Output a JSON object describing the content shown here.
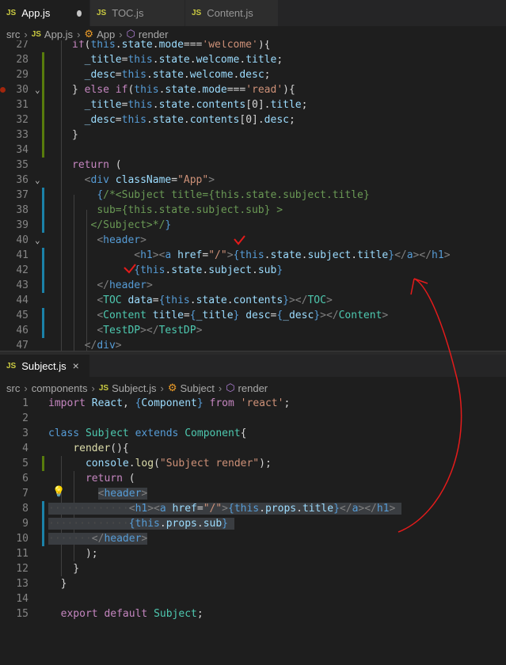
{
  "tabs": [
    {
      "label": "App.js",
      "active": true,
      "modified": true
    },
    {
      "label": "TOC.js",
      "active": false
    },
    {
      "label": "Content.js",
      "active": false
    }
  ],
  "breadcrumb_top": {
    "folder": "src",
    "file": "App.js",
    "class": "App",
    "method": "render"
  },
  "breadcrumb_bottom": {
    "folder": "src",
    "sub": "components",
    "file": "Subject.js",
    "class": "Subject",
    "method": "render"
  },
  "bottom_tab": {
    "label": "Subject.js",
    "close": "×"
  },
  "top_lines": [
    {
      "n": "27",
      "html": "<span class='c'>if</span>(<span class='k'>this</span>.<span class='v'>state</span>.<span class='v'>mode</span>===<span class='s'>'welcome'</span>){"
    },
    {
      "n": "28",
      "html": "  <span class='v'>_title</span>=<span class='k'>this</span>.<span class='v'>state</span>.<span class='v'>welcome</span>.<span class='v'>title</span>;"
    },
    {
      "n": "29",
      "html": "  <span class='v'>_desc</span>=<span class='k'>this</span>.<span class='v'>state</span>.<span class='v'>welcome</span>.<span class='v'>desc</span>;"
    },
    {
      "n": "30",
      "html": "} <span class='c'>else if</span>(<span class='k'>this</span>.<span class='v'>state</span>.<span class='v'>mode</span>===<span class='s'>'read'</span>){"
    },
    {
      "n": "31",
      "html": "  <span class='v'>_title</span>=<span class='k'>this</span>.<span class='v'>state</span>.<span class='v'>contents</span>[<span class='p'>0</span>].<span class='v'>title</span>;"
    },
    {
      "n": "32",
      "html": "  <span class='v'>_desc</span>=<span class='k'>this</span>.<span class='v'>state</span>.<span class='v'>contents</span>[<span class='p'>0</span>].<span class='v'>desc</span>;"
    },
    {
      "n": "33",
      "html": "}"
    },
    {
      "n": "34",
      "html": ""
    },
    {
      "n": "35",
      "html": "<span class='c'>return</span> ("
    },
    {
      "n": "36",
      "html": "  <span class='g'>&lt;</span><span class='tg'>div</span> <span class='v'>className</span>=<span class='s'>\"App\"</span><span class='g'>&gt;</span>"
    },
    {
      "n": "37",
      "html": "    <span class='k'>{</span><span class='cm'>/*&lt;Subject title={this.state.subject.title}</span>"
    },
    {
      "n": "38",
      "html": "    <span class='cm'>sub={this.state.subject.sub} &gt;</span>"
    },
    {
      "n": "39",
      "html": "   <span class='cm'>&lt;/Subject&gt;*/</span><span class='k'>}</span>"
    },
    {
      "n": "40",
      "html": "    <span class='g'>&lt;</span><span class='tg'>header</span><span class='g'>&gt;</span>"
    },
    {
      "n": "41",
      "html": "          <span class='g'>&lt;</span><span class='tg'>h1</span><span class='g'>&gt;&lt;</span><span class='tg'>a</span> <span class='v'>href</span>=<span class='s'>\"/\"</span><span class='g'>&gt;</span><span class='k'>{</span><span class='k'>this</span>.<span class='v'>state</span>.<span class='v'>subject</span>.<span class='v'>title</span><span class='k'>}</span><span class='g'>&lt;/</span><span class='tg'>a</span><span class='g'>&gt;&lt;/</span><span class='tg'>h1</span><span class='g'>&gt;</span>"
    },
    {
      "n": "42",
      "html": "          <span class='k'>{</span><span class='k'>this</span>.<span class='v'>state</span>.<span class='v'>subject</span>.<span class='v'>sub</span><span class='k'>}</span>"
    },
    {
      "n": "43",
      "html": "    <span class='g'>&lt;/</span><span class='tg'>header</span><span class='g'>&gt;</span>"
    },
    {
      "n": "44",
      "html": "    <span class='g'>&lt;</span><span class='t'>TOC</span> <span class='v'>data</span>=<span class='k'>{</span><span class='k'>this</span>.<span class='v'>state</span>.<span class='v'>contents</span><span class='k'>}</span><span class='g'>&gt;&lt;/</span><span class='t'>TOC</span><span class='g'>&gt;</span>"
    },
    {
      "n": "45",
      "html": "    <span class='g'>&lt;</span><span class='t'>Content</span> <span class='v'>title</span>=<span class='k'>{</span><span class='v'>_title</span><span class='k'>}</span> <span class='v'>desc</span>=<span class='k'>{</span><span class='v'>_desc</span><span class='k'>}</span><span class='g'>&gt;&lt;/</span><span class='t'>Content</span><span class='g'>&gt;</span>"
    },
    {
      "n": "46",
      "html": "    <span class='g'>&lt;</span><span class='t'>TestDP</span><span class='g'>&gt;&lt;/</span><span class='t'>TestDP</span><span class='g'>&gt;</span>"
    },
    {
      "n": "47",
      "html": "  <span class='g'>&lt;/</span><span class='tg'>div</span><span class='g'>&gt;</span>"
    }
  ],
  "bottom_lines": [
    {
      "n": "1",
      "html": "<span class='c'>import</span> <span class='v'>React</span>, <span class='k'>{</span><span class='v'>Component</span><span class='k'>}</span> <span class='c'>from</span> <span class='s'>'react'</span>;"
    },
    {
      "n": "2",
      "html": ""
    },
    {
      "n": "3",
      "html": "<span class='k'>class</span> <span class='t'>Subject</span> <span class='k'>extends</span> <span class='t'>Component</span>{"
    },
    {
      "n": "4",
      "html": "    <span class='f'>render</span>(){"
    },
    {
      "n": "5",
      "html": "      <span class='v'>console</span>.<span class='f'>log</span>(<span class='s'>\"Subject render\"</span>);"
    },
    {
      "n": "6",
      "html": "      <span class='c'>return</span> ("
    },
    {
      "n": "7",
      "html": "        <span class='sel'><span class='g'>&lt;</span><span class='tg'>header</span><span class='g'>&gt;</span></span>"
    },
    {
      "n": "8",
      "html": "<span class='sel'><span class='ws'>·············</span><span class='g'>&lt;</span><span class='tg'>h1</span><span class='g'>&gt;&lt;</span><span class='tg'>a</span> <span class='v'>href</span>=<span class='s'>\"/\"</span><span class='g'>&gt;</span><span class='k'>{</span><span class='k'>this</span>.<span class='v'>props</span>.<span class='v'>title</span><span class='k'>}</span><span class='g'>&lt;/</span><span class='tg'>a</span><span class='g'>&gt;&lt;/</span><span class='tg'>h1</span><span class='g'>&gt;</span> </span>"
    },
    {
      "n": "9",
      "html": "<span class='sel'><span class='ws'>·············</span><span class='k'>{</span><span class='k'>this</span>.<span class='v'>props</span>.<span class='v'>sub</span><span class='k'>}</span> </span>"
    },
    {
      "n": "10",
      "html": "<span class='sel'><span class='ws'>·······</span><span class='g'>&lt;/</span><span class='tg'>header</span><span class='g'>&gt;</span></span>"
    },
    {
      "n": "11",
      "html": "      );"
    },
    {
      "n": "12",
      "html": "    }"
    },
    {
      "n": "13",
      "html": "  }"
    },
    {
      "n": "14",
      "html": ""
    },
    {
      "n": "15",
      "html": "  <span class='c'>export</span> <span class='c'>default</span> <span class='t'>Subject</span>;"
    }
  ]
}
